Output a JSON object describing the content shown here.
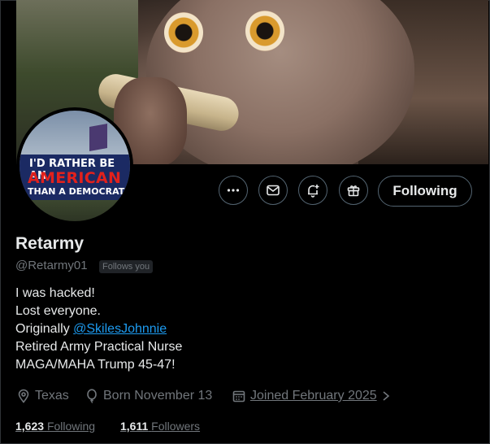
{
  "profile": {
    "name": "Retarmy",
    "handle": "@Retarmy01",
    "follows_you": "Follows you",
    "follow_button": "Following",
    "avatar_sign": {
      "line1": "I'D RATHER BE AN",
      "line2": "AMERICAN",
      "line3": "THAN A DEMOCRAT"
    },
    "bio": {
      "line1": "I was hacked!",
      "line2": "Lost everyone.",
      "line3_prefix": "Originally ",
      "line3_link": "@SkilesJohnnie",
      "line4": "Retired Army Practical Nurse",
      "line5": "MAGA/MAHA Trump 45-47!"
    },
    "meta": {
      "location": "Texas",
      "born": "Born November 13",
      "joined": "Joined February 2025"
    },
    "stats": {
      "following_count": "1,623",
      "following_label": "Following",
      "followers_count": "1,611",
      "followers_label": "Followers"
    }
  },
  "actions": [
    "more-icon",
    "message-icon",
    "notify-icon",
    "subscribe-icon"
  ],
  "colors": {
    "link": "#1d9bf0",
    "muted": "#71767b",
    "text": "#e7e9ea",
    "border": "#536471",
    "avatar_red": "#e2211c",
    "avatar_navy": "#1b2a63"
  }
}
